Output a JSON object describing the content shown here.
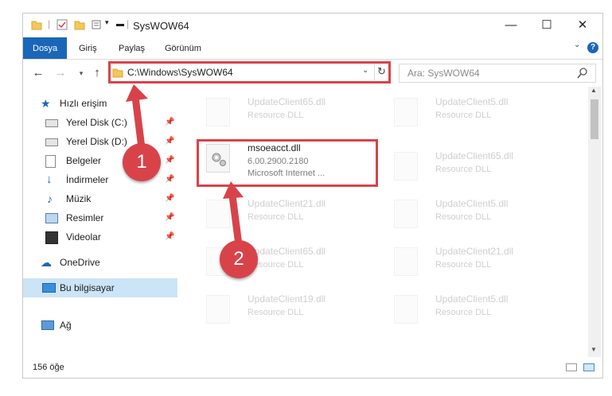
{
  "window": {
    "title": "SysWOW64",
    "caption": {
      "minimize": "—",
      "maximize": "☐",
      "close": "✕"
    }
  },
  "ribbon": {
    "tabs": [
      {
        "label": "Dosya"
      },
      {
        "label": "Giriş"
      },
      {
        "label": "Paylaş"
      },
      {
        "label": "Görünüm"
      }
    ],
    "help": "?"
  },
  "address": {
    "path": "C:\\Windows\\SysWOW64",
    "search_placeholder": "Ara: SysWOW64"
  },
  "nav": {
    "quick_access": "Hızlı erişim",
    "items": [
      {
        "label": "Yerel Disk (C:)"
      },
      {
        "label": "Yerel Disk (D:)"
      },
      {
        "label": "Belgeler"
      },
      {
        "label": "İndirmeler"
      },
      {
        "label": "Müzik"
      },
      {
        "label": "Resimler"
      },
      {
        "label": "Videolar"
      }
    ],
    "onedrive": "OneDrive",
    "this_pc": "Bu bilgisayar",
    "network": "Ağ"
  },
  "files": {
    "left": [
      {
        "name": "UpdateClient65.dll",
        "sub": "Resource DLL"
      },
      {
        "name": "msoeacct.dll",
        "sub": "6.00.2900.2180",
        "sub2": "Microsoft Internet ..."
      },
      {
        "name": "UpdateClient21.dll",
        "sub": "Resource DLL"
      },
      {
        "name": "UpdateClient65.dll",
        "sub": "Resource DLL"
      },
      {
        "name": "UpdateClient19.dll",
        "sub": "Resource DLL"
      }
    ],
    "right": [
      {
        "name": "UpdateClient5.dll",
        "sub": "Resource DLL"
      },
      {
        "name": "UpdateClient65.dll",
        "sub": "Resource DLL"
      },
      {
        "name": "UpdateClient5.dll",
        "sub": "Resource DLL"
      },
      {
        "name": "UpdateClient21.dll",
        "sub": "Resource DLL"
      },
      {
        "name": "UpdateClient5.dll",
        "sub": "Resource DLL"
      }
    ]
  },
  "status": {
    "count": "156 öğe"
  },
  "callouts": {
    "one": "1",
    "two": "2"
  },
  "colors": {
    "accent": "#1a66b8",
    "highlight": "#d8434a",
    "selected": "#cce4f7"
  }
}
